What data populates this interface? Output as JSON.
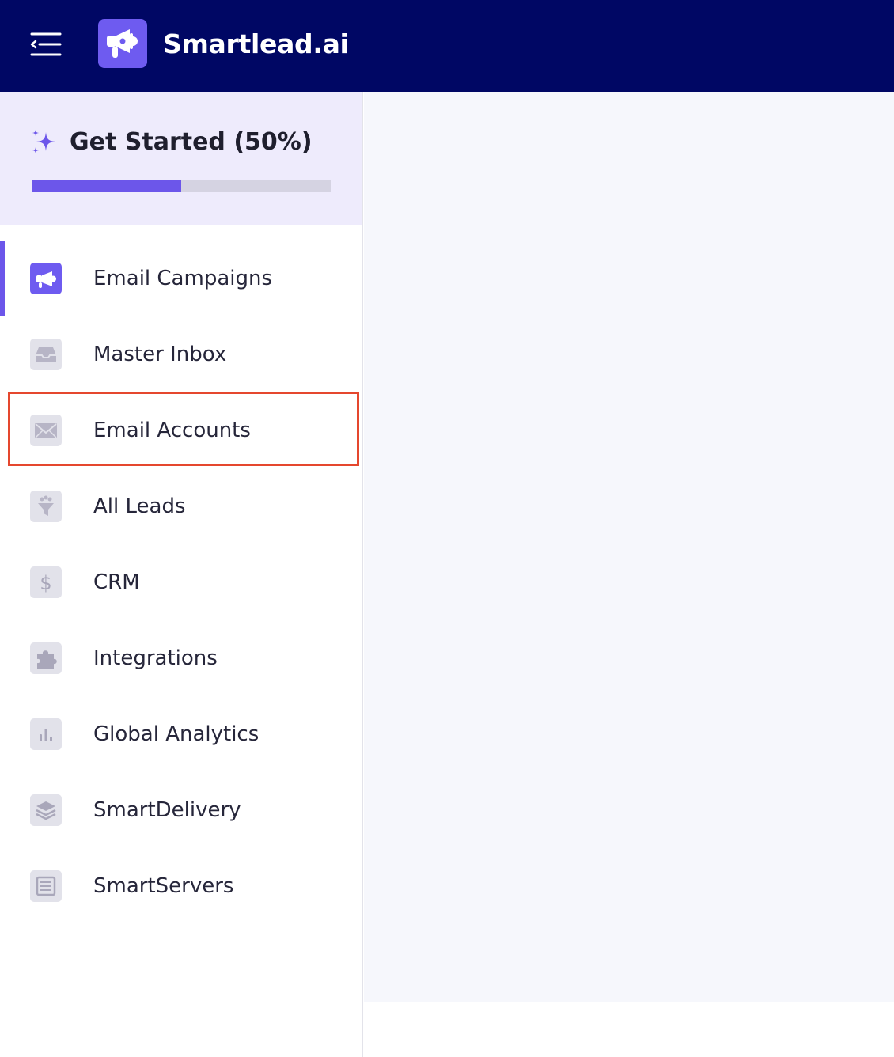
{
  "header": {
    "brand": "Smartlead.ai",
    "menu_icon": "menu-collapse-icon",
    "logo_icon": "megaphone-icon",
    "background": "#000764"
  },
  "get_started": {
    "title": "Get Started (50%)",
    "progress_percent": 50,
    "icon": "sparkle-icon",
    "accent": "#6c56ea"
  },
  "nav": {
    "items": [
      {
        "label": "Email Campaigns",
        "icon": "megaphone-icon",
        "active": true
      },
      {
        "label": "Master Inbox",
        "icon": "inbox-icon",
        "active": false
      },
      {
        "label": "Email Accounts",
        "icon": "envelope-icon",
        "active": false,
        "highlighted": true
      },
      {
        "label": "All Leads",
        "icon": "funnel-icon",
        "active": false
      },
      {
        "label": "CRM",
        "icon": "dollar-icon",
        "active": false
      },
      {
        "label": "Integrations",
        "icon": "puzzle-icon",
        "active": false
      },
      {
        "label": "Global Analytics",
        "icon": "bar-chart-icon",
        "active": false
      },
      {
        "label": "SmartDelivery",
        "icon": "layers-icon",
        "active": false
      },
      {
        "label": "SmartServers",
        "icon": "server-icon",
        "active": false
      }
    ]
  },
  "colors": {
    "highlight_border": "#e5472e",
    "main_background": "#f6f7fc"
  }
}
